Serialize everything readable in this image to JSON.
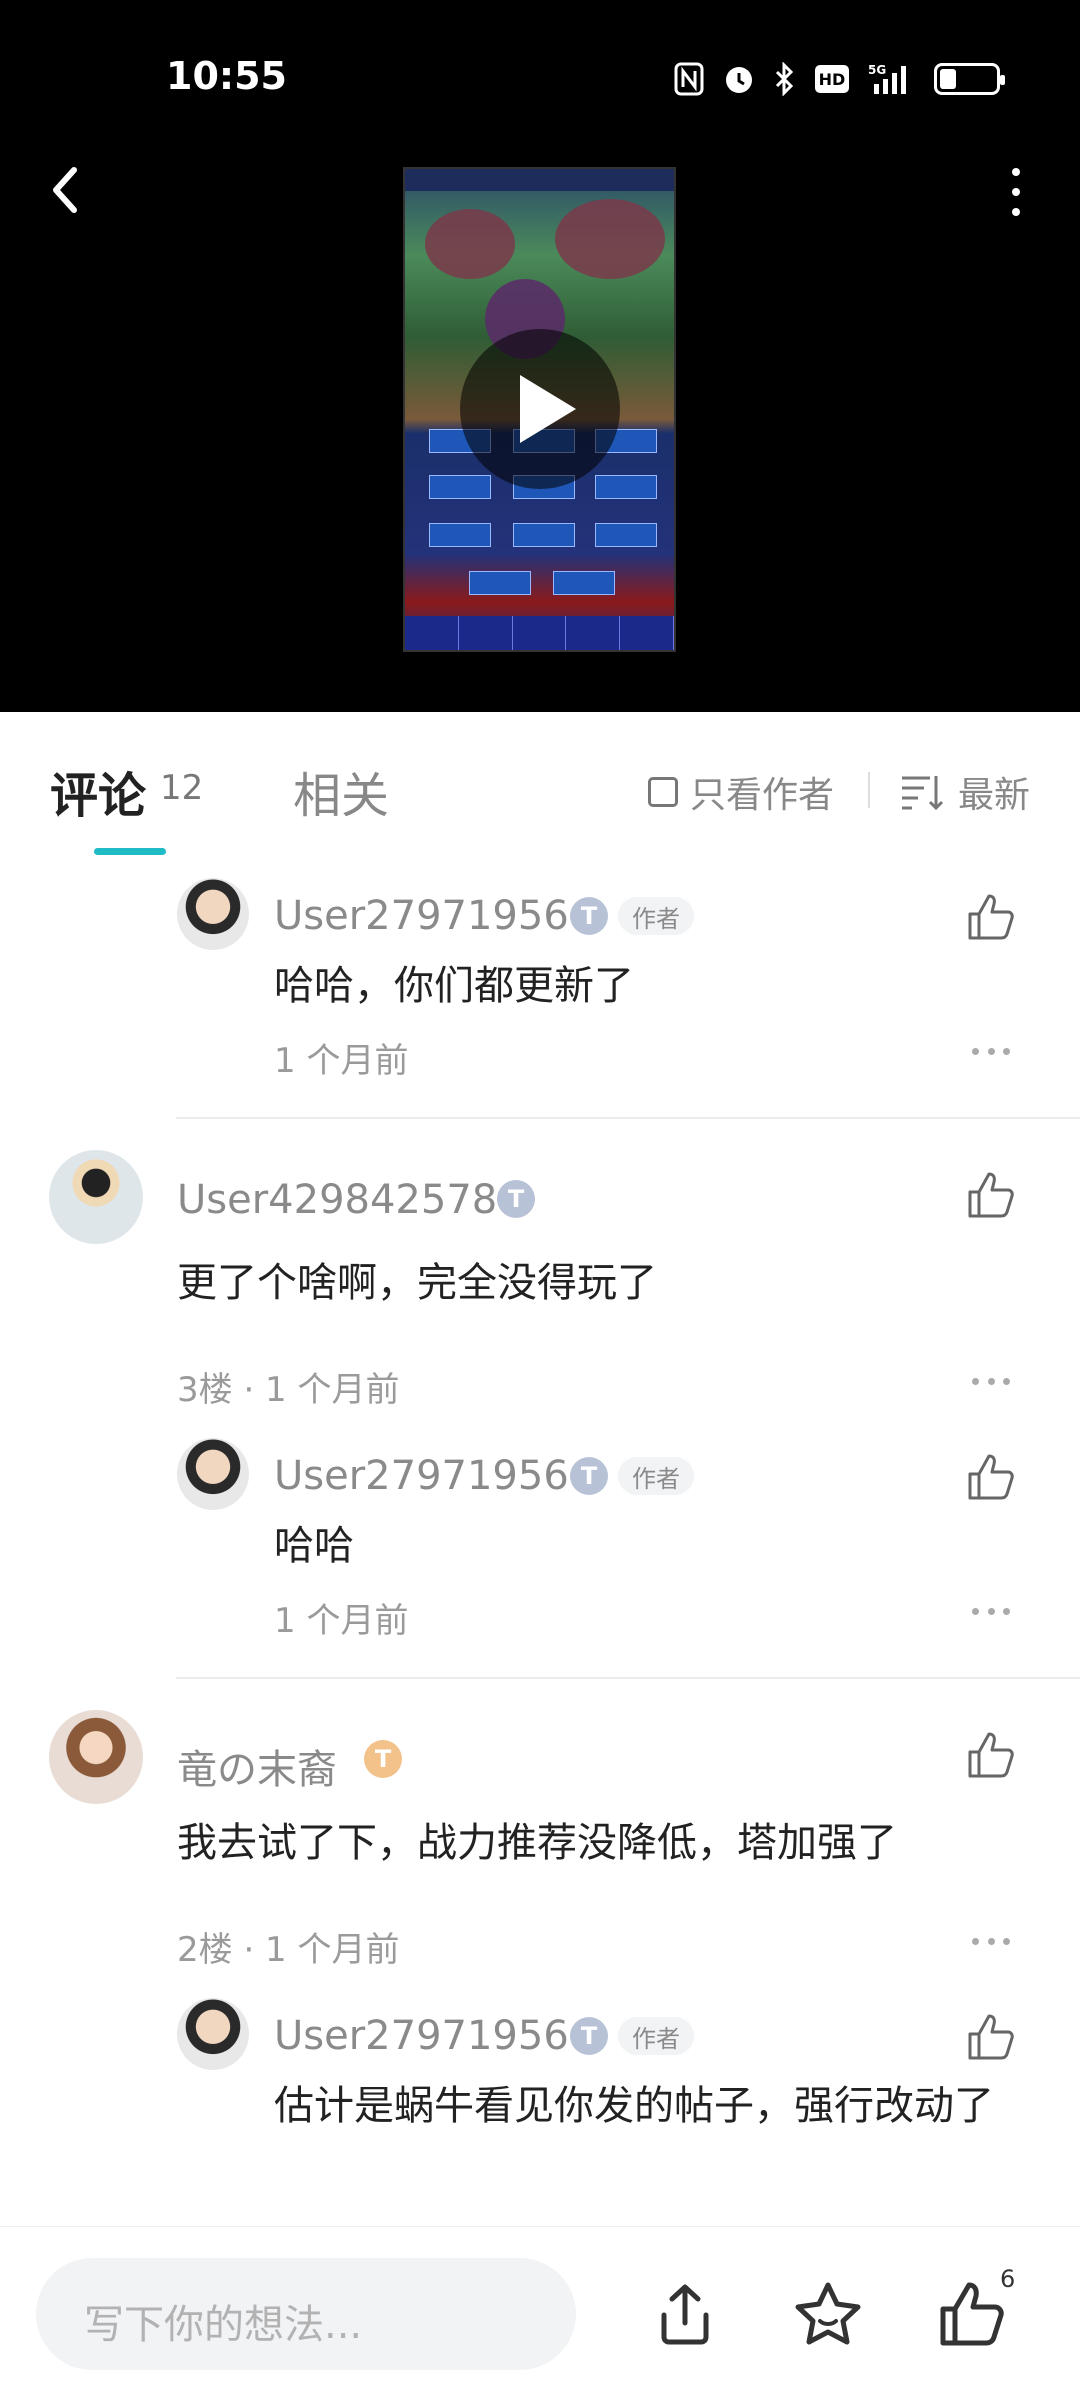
{
  "status_bar": {
    "time": "10:55",
    "icons": [
      "nfc-icon",
      "alarm-icon",
      "bluetooth-icon",
      "hd-icon",
      "5g-signal-icon",
      "battery-icon"
    ],
    "hd_label": "HD",
    "network_label": "5G",
    "battery_level": 0.3
  },
  "header": {
    "back_icon": "chevron-left-icon",
    "more_icon": "more-vertical-icon"
  },
  "video": {
    "play_icon": "play-icon"
  },
  "tabs": {
    "comments_label": "评论",
    "comments_count": "12",
    "related_label": "相关",
    "only_author_label": "只看作者",
    "sort_label": "最新"
  },
  "comments": [
    {
      "type": "reply",
      "username": "User27971956",
      "badge": "T",
      "author_tag": "作者",
      "text": "哈哈，你们都更新了",
      "meta": "1 个月前"
    },
    {
      "type": "top",
      "username": "User429842578",
      "badge": "T",
      "text": "更了个啥啊，完全没得玩了",
      "meta": "3楼 · 1 个月前"
    },
    {
      "type": "reply",
      "username": "User27971956",
      "badge": "T",
      "author_tag": "作者",
      "text": "哈哈",
      "meta": "1 个月前"
    },
    {
      "type": "top",
      "username": "竜の末裔",
      "badge": "T",
      "text": "我去试了下，战力推荐没降低，塔加强了",
      "meta": "2楼 · 1 个月前"
    },
    {
      "type": "reply",
      "username": "User27971956",
      "badge": "T",
      "author_tag": "作者",
      "text": "估计是蜗牛看见你发的帖子，强行改动了",
      "meta": ""
    }
  ],
  "bottom_bar": {
    "input_placeholder": "写下你的想法...",
    "share_icon": "share-icon",
    "favorite_icon": "star-icon",
    "like_icon": "thumbs-up-icon",
    "like_count": "6"
  },
  "colors": {
    "accent": "#1fbcc6",
    "badge_t3": "#b8c2d6",
    "badge_t5": "#f2c28a"
  }
}
